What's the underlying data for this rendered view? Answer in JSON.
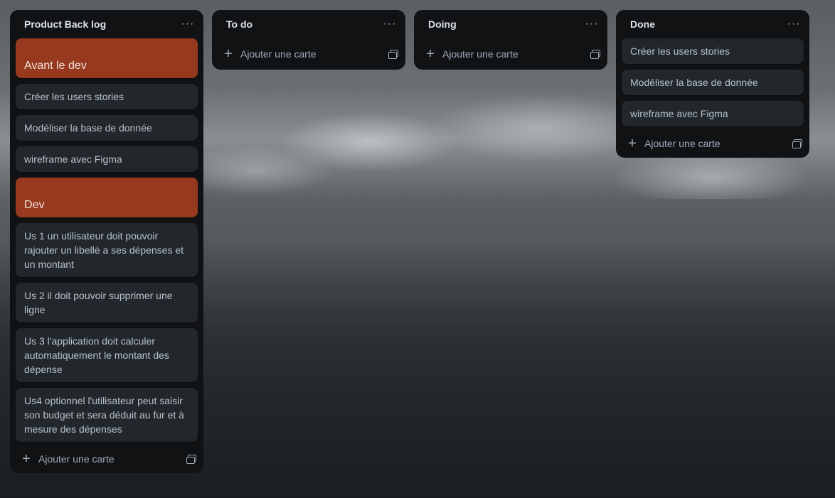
{
  "board": {
    "lists": [
      {
        "title": "Product Back log",
        "menu": "···",
        "cards": [
          {
            "text": "Avant le dev",
            "kind": "section"
          },
          {
            "text": "Créer les users stories",
            "kind": "card"
          },
          {
            "text": "Modéliser la base de donnée",
            "kind": "card"
          },
          {
            "text": "wireframe avec Figma",
            "kind": "card"
          },
          {
            "text": "Dev",
            "kind": "section"
          },
          {
            "text": "Us 1 un utilisateur doit pouvoir rajouter un libellé a ses dépenses et un montant",
            "kind": "card"
          },
          {
            "text": "Us 2 il doit pouvoir supprimer une ligne",
            "kind": "card"
          },
          {
            "text": "Us 3 l'application doit calculer automatiquement le montant des dépense",
            "kind": "card"
          },
          {
            "text": "Us4 optionnel l'utilisateur peut saisir son budget et sera déduit au fur et à mesure des dépenses",
            "kind": "card"
          }
        ],
        "add_label": "Ajouter une carte"
      },
      {
        "title": "To do",
        "menu": "···",
        "cards": [],
        "add_label": "Ajouter une carte"
      },
      {
        "title": "Doing",
        "menu": "···",
        "cards": [],
        "add_label": "Ajouter une carte"
      },
      {
        "title": "Done",
        "menu": "···",
        "cards": [
          {
            "text": "Créer les users stories",
            "kind": "card"
          },
          {
            "text": "Modéliser la base de donnée",
            "kind": "card"
          },
          {
            "text": "wireframe avec Figma",
            "kind": "card"
          }
        ],
        "add_label": "Ajouter une carte"
      }
    ]
  },
  "colors": {
    "list_bg": "#111214",
    "card_bg": "#22272b",
    "section_bg": "#97391e",
    "text": "#b6c2cf"
  },
  "icons": {
    "menu": "more-horizontal-icon",
    "add": "plus-icon",
    "template": "card-template-icon"
  }
}
